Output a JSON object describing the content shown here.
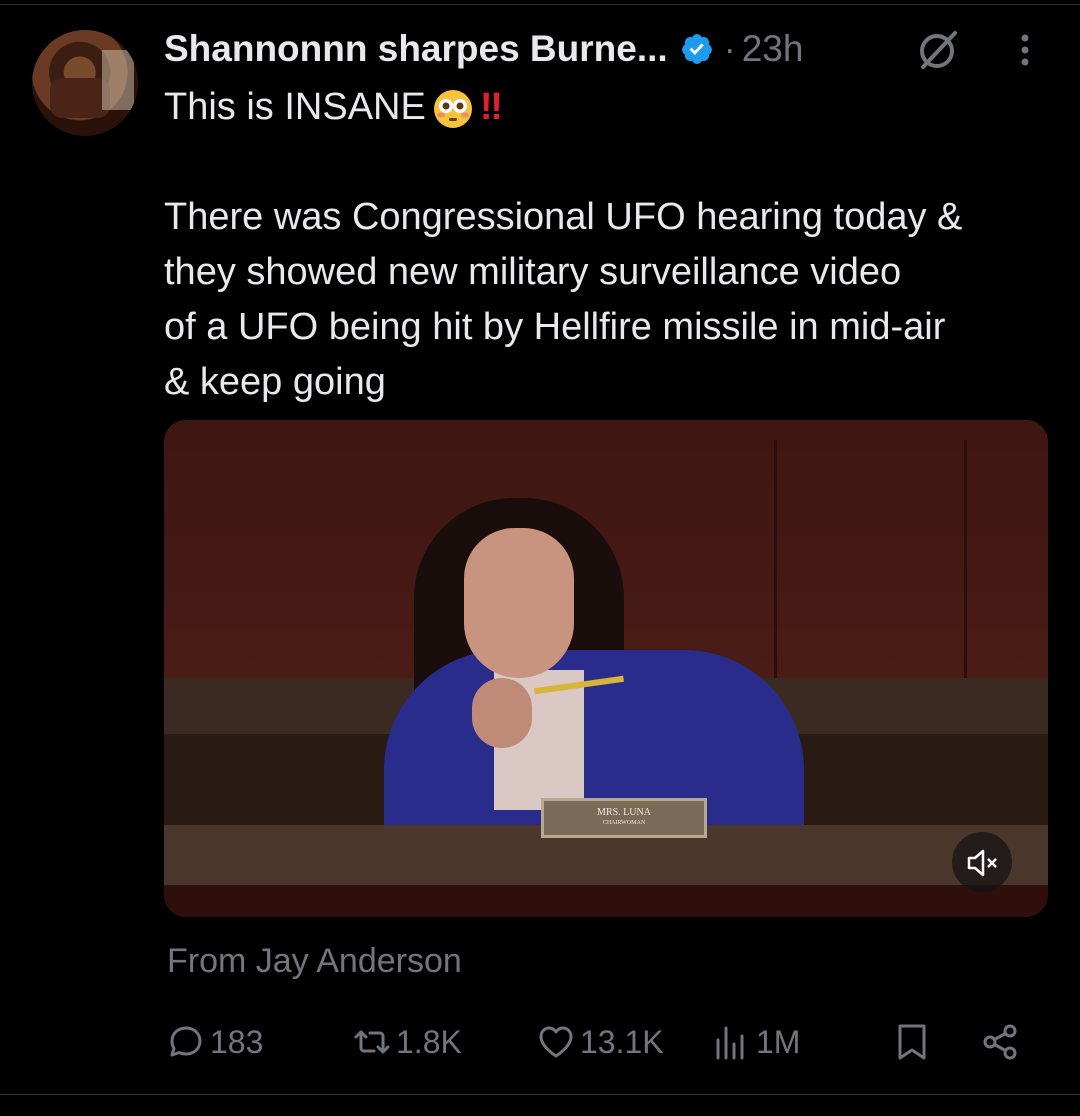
{
  "tweet": {
    "display_name": "Shannonnn sharpes Burne...",
    "separator": "·",
    "time": "23h",
    "line1": "This is INSANE",
    "line1_bang": "‼",
    "body_lines": [
      "There was Congressional UFO hearing today &",
      "they showed new military surveillance video",
      "of a UFO being hit by Hellfire missile in mid-air",
      "& keep going"
    ],
    "attribution": "From Jay Anderson"
  },
  "media": {
    "nameplate_line1": "MRS. LUNA",
    "nameplate_line2": "CHAIRWOMAN",
    "mute_icon": "volume-muted-icon"
  },
  "actions": {
    "replies": "183",
    "reposts": "1.8K",
    "likes": "13.1K",
    "views": "1M"
  },
  "colors": {
    "background": "#000000",
    "text": "#e7e9ea",
    "muted": "#71767b",
    "verified": "#1d9bf0"
  }
}
